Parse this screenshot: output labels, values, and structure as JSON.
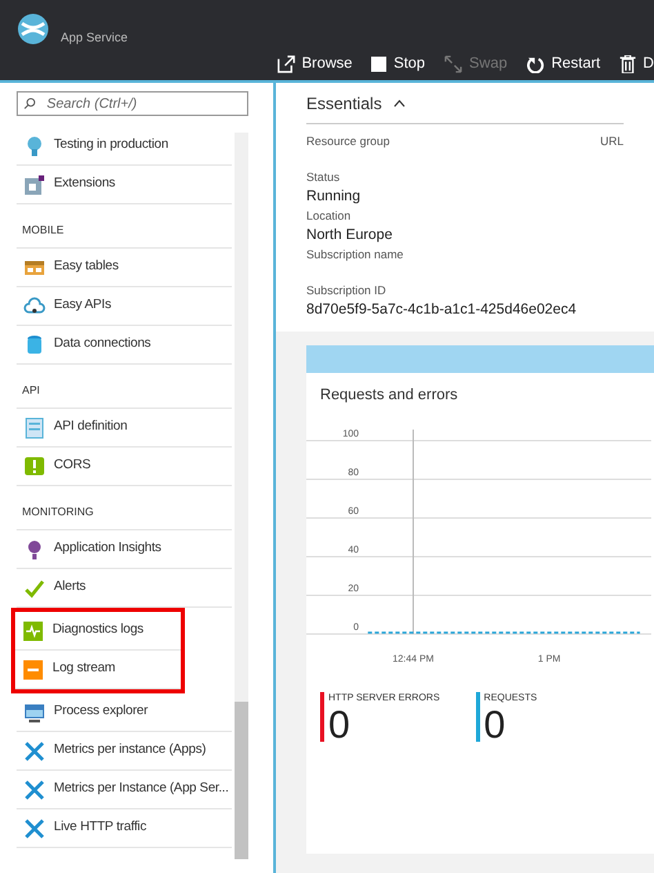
{
  "header": {
    "subtitle": "App Service"
  },
  "toolbar": [
    {
      "label": "Browse",
      "disabled": false
    },
    {
      "label": "Stop",
      "disabled": false
    },
    {
      "label": "Swap",
      "disabled": true
    },
    {
      "label": "Restart",
      "disabled": false
    },
    {
      "label": "D",
      "disabled": false
    }
  ],
  "sidebar": {
    "search": {
      "placeholder": "Search (Ctrl+/)"
    },
    "sections": [
      {
        "items": [
          {
            "label": "Testing in production",
            "highlighted": false
          },
          {
            "label": "Extensions",
            "highlighted": false
          }
        ]
      },
      {
        "heading": "MOBILE",
        "items": [
          {
            "label": "Easy tables",
            "highlighted": false
          },
          {
            "label": "Easy APIs",
            "highlighted": false
          },
          {
            "label": "Data connections",
            "highlighted": false
          }
        ]
      },
      {
        "heading": "API",
        "items": [
          {
            "label": "API definition",
            "highlighted": false
          },
          {
            "label": "CORS",
            "highlighted": false
          }
        ]
      },
      {
        "heading": "MONITORING",
        "items": [
          {
            "label": "Application Insights",
            "highlighted": false
          },
          {
            "label": "Alerts",
            "highlighted": false
          },
          {
            "label": "Diagnostics logs",
            "highlighted": true
          },
          {
            "label": "Log stream",
            "highlighted": true
          },
          {
            "label": "Process explorer",
            "highlighted": false
          },
          {
            "label": "Metrics per instance (Apps)",
            "highlighted": false
          },
          {
            "label": "Metrics per Instance (App Ser...",
            "highlighted": false
          },
          {
            "label": "Live HTTP traffic",
            "highlighted": false
          }
        ]
      }
    ]
  },
  "essentials": {
    "title": "Essentials",
    "expanded": true,
    "fields": [
      {
        "label": "Resource group"
      },
      {
        "label": "Status",
        "value": "Running"
      },
      {
        "label": "Location",
        "value": "North Europe"
      },
      {
        "label": "Subscription name"
      },
      {
        "label": "Subscription ID",
        "value": "8d70e5f9-5a7c-4c1b-a1c1-425d46e02ec4"
      }
    ],
    "column_2_label": "URL"
  },
  "chart_card": {
    "title": "Requests and errors",
    "chart_data": {
      "type": "line",
      "categories": [
        null,
        null,
        null,
        "12:44 PM",
        null,
        null,
        null,
        null,
        null,
        "1 PM",
        null,
        null,
        null,
        null
      ],
      "grid": true,
      "series": [
        {
          "color": "#2ba6d8",
          "line_style": "dashed",
          "values": [
            null,
            0,
            0,
            0,
            0,
            0,
            0,
            0,
            0,
            0,
            0,
            0,
            0,
            0
          ]
        }
      ],
      "ylim": [
        0,
        100
      ],
      "yticks": [
        0,
        20,
        40,
        60,
        80,
        100
      ]
    },
    "tiles": [
      {
        "label": "HTTP SERVER ERRORS",
        "value": "0",
        "color": "#e81123"
      },
      {
        "label": "REQUESTS",
        "value": "0",
        "color": "#1fa8d8"
      }
    ]
  }
}
